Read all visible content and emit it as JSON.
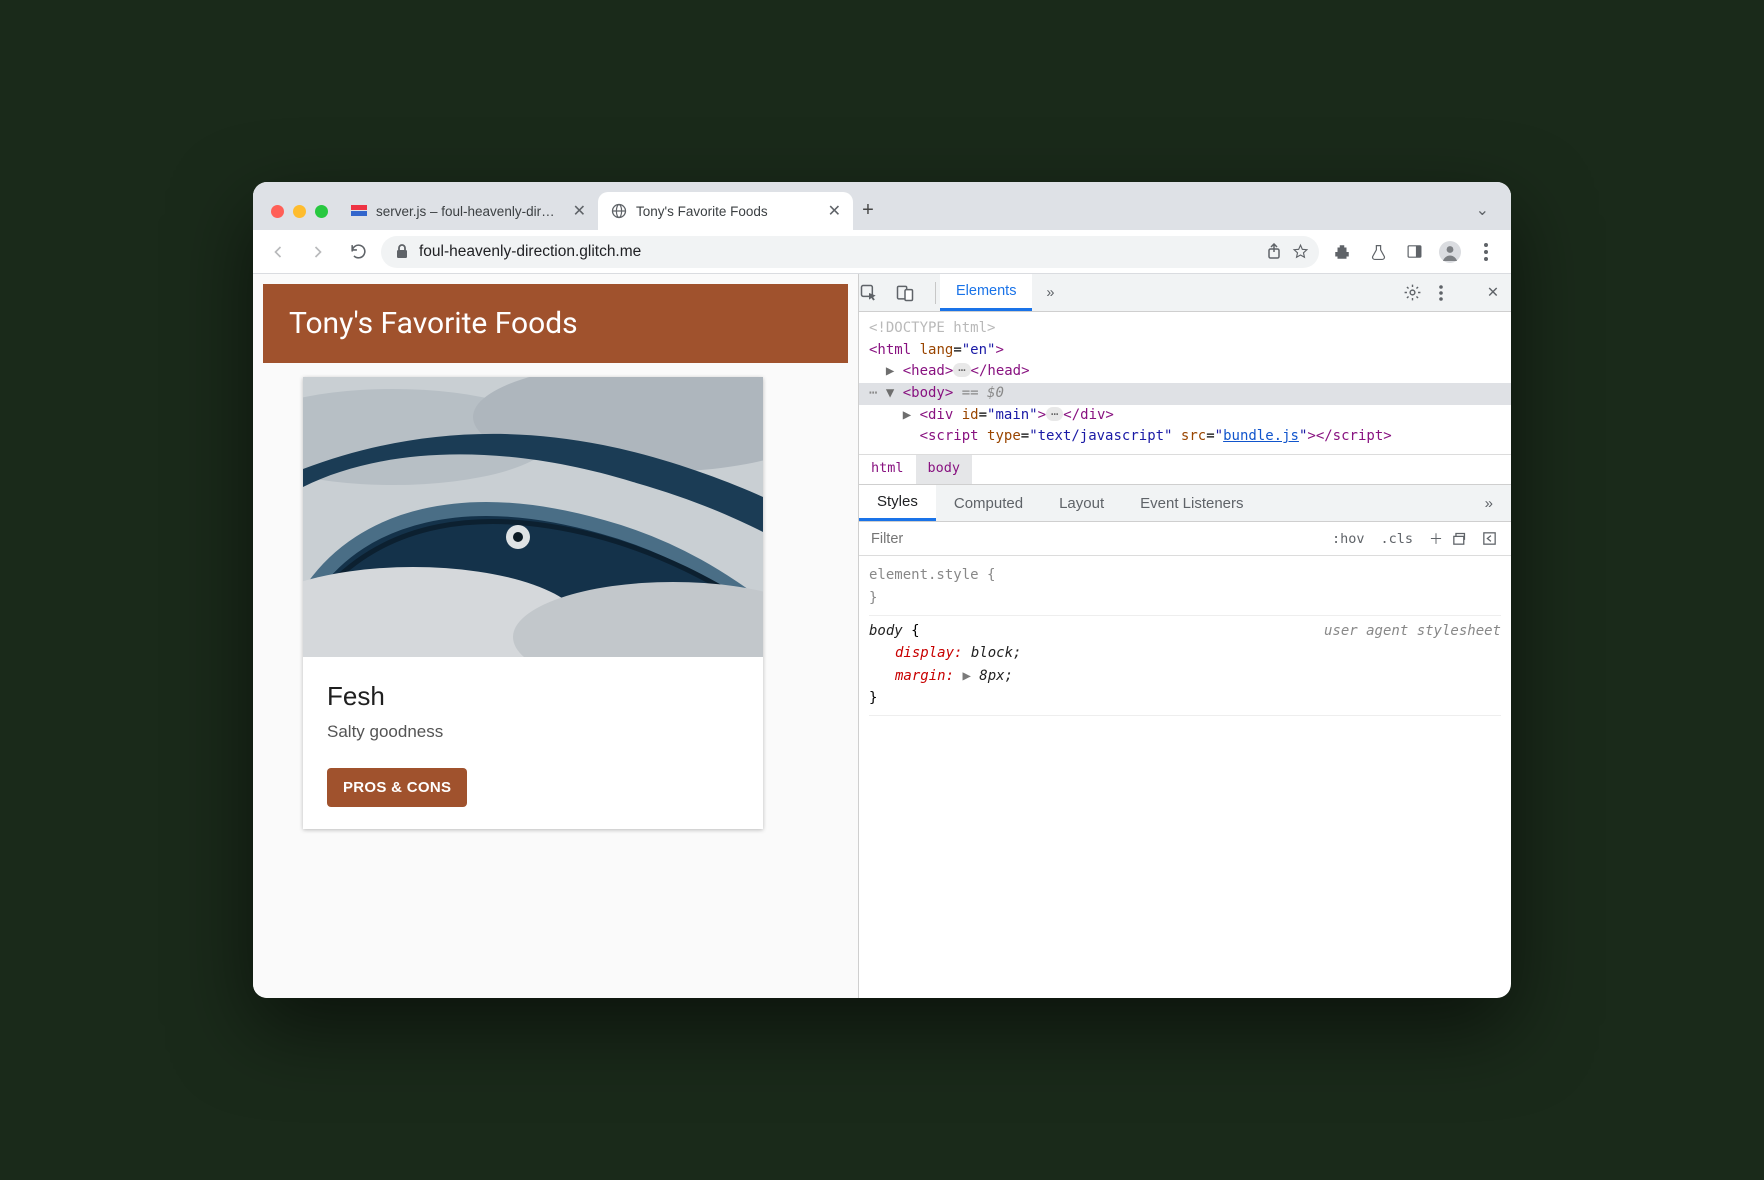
{
  "tabs": [
    {
      "title": "server.js – foul-heavenly-direct",
      "active": false
    },
    {
      "title": "Tony's Favorite Foods",
      "active": true
    }
  ],
  "toolbar": {
    "url": "foul-heavenly-direction.glitch.me"
  },
  "page": {
    "header": "Tony's Favorite Foods",
    "card": {
      "title": "Fesh",
      "subtitle": "Salty goodness",
      "button": "PROS & CONS",
      "image_alt": "pile of fresh fish"
    }
  },
  "devtools": {
    "top_tabs": {
      "active": "Elements"
    },
    "dom": {
      "doctype": "<!DOCTYPE html>",
      "html_open": "<html lang=\"en\">",
      "head": "<head> … </head>",
      "body_open": "<body>",
      "body_suffix": " == $0",
      "div_main": "<div id=\"main\"> … </div>",
      "script_line1": "<script type=\"text/javascript\" src=\"",
      "script_link": "bundle.js",
      "script_line2": "\"></script>"
    },
    "breadcrumb": [
      "html",
      "body"
    ],
    "styles_tabs": [
      "Styles",
      "Computed",
      "Layout",
      "Event Listeners"
    ],
    "filter_placeholder": "Filter",
    "filter_tools": {
      "hov": ":hov",
      "cls": ".cls"
    },
    "rules": {
      "element_style_sel": "element.style",
      "body_sel": "body",
      "body_src": "user agent stylesheet",
      "body_props": [
        {
          "name": "display",
          "value": "block;"
        },
        {
          "name": "margin",
          "value": "8px;",
          "expand": true
        }
      ]
    }
  }
}
